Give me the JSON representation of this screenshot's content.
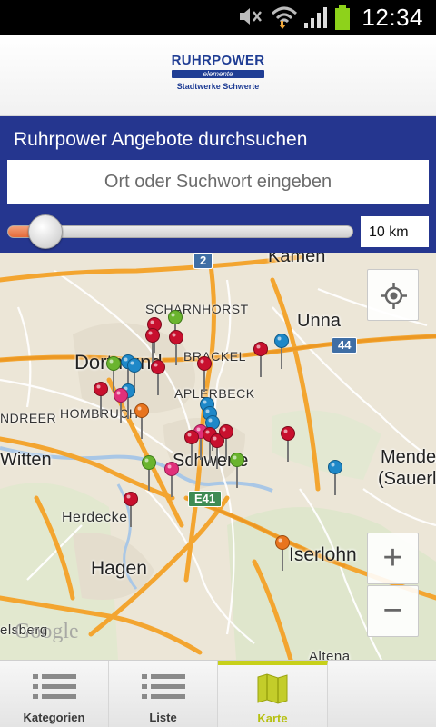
{
  "status_bar": {
    "time": "12:34",
    "icons": [
      "mute-icon",
      "wifi-icon",
      "signal-icon",
      "battery-icon"
    ]
  },
  "header": {
    "logo": {
      "name": "RUHRPOWER",
      "tagline": "elemente",
      "company": "Stadtwerke Schwerte"
    }
  },
  "search": {
    "title": "Ruhrpower Angebote durchsuchen",
    "placeholder": "Ort oder Suchwort eingeben",
    "radius_value": "10 km",
    "slider_level": 0.07
  },
  "map": {
    "places": [
      "Kamen",
      "SCHARNHORST",
      "Unna",
      "Dortmund",
      "BRACKEL",
      "APLERBECK",
      "HOMBRUCH",
      "NDREER",
      "Witten",
      "Schwerte",
      "Menden",
      "(Sauerla",
      "Herdecke",
      "Hagen",
      "Iserlohn",
      "elsberg",
      "Altena"
    ],
    "road_shields": [
      "2",
      "44",
      "E41"
    ],
    "watermark": "Google",
    "controls": {
      "locate": "locate-icon",
      "zoom_in": "+",
      "zoom_out": "−"
    },
    "colors": {
      "marker_red": "#c8102e",
      "marker_blue": "#1e88c8",
      "marker_green": "#6ab42e",
      "marker_pink": "#e0307a",
      "marker_orange": "#e8741e",
      "road": "#f7ad32"
    }
  },
  "tabs": [
    {
      "label": "Kategorien",
      "icon": "list-icon"
    },
    {
      "label": "Liste",
      "icon": "list-icon"
    },
    {
      "label": "Karte",
      "icon": "map-icon",
      "active": true
    }
  ]
}
